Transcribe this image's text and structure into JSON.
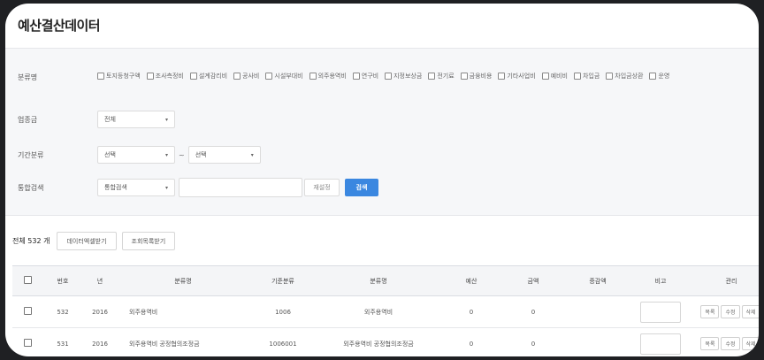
{
  "page_title": "예산결산데이터",
  "filters": {
    "category": {
      "label": "분류명",
      "options": [
        "토지등청구액",
        "조사측정비",
        "설계감리비",
        "공사비",
        "시설부대비",
        "외주용역비",
        "연구비",
        "지정보상금",
        "전기료",
        "금융비용",
        "기타사업비",
        "예비비",
        "차입금",
        "차입금상환",
        "운영"
      ]
    },
    "division": {
      "label": "업종금",
      "value": "전체"
    },
    "period": {
      "label": "기간분류",
      "from": "선택",
      "separator": "~",
      "to": "선택"
    },
    "search": {
      "label": "통합검색",
      "type_value": "통합검색",
      "query_value": "",
      "reset_label": "재설정",
      "search_label": "검색"
    }
  },
  "toolbar": {
    "total_text": "전체 532 개",
    "excel_label": "데이터엑셀받기",
    "print_label": "조회목록받기"
  },
  "table": {
    "headers": [
      "번호",
      "년",
      "분류명",
      "기준분류",
      "분류명",
      "예산",
      "금액",
      "증감액",
      "비고",
      "관리"
    ],
    "rows": [
      {
        "no": "532",
        "year": "2016",
        "name": "외주용역비",
        "code": "1006",
        "name2": "외주용역비",
        "budget": "0",
        "amount": "0",
        "diff": "",
        "btn1": "목록",
        "btn2": "수정",
        "btn3": "삭제"
      },
      {
        "no": "531",
        "year": "2016",
        "name": "외주용역비 공정협의조정금",
        "code": "1006001",
        "name2": "외주용역비 공정협의조정금",
        "budget": "0",
        "amount": "0",
        "diff": "",
        "btn1": "목록",
        "btn2": "수정",
        "btn3": "삭제"
      }
    ]
  }
}
